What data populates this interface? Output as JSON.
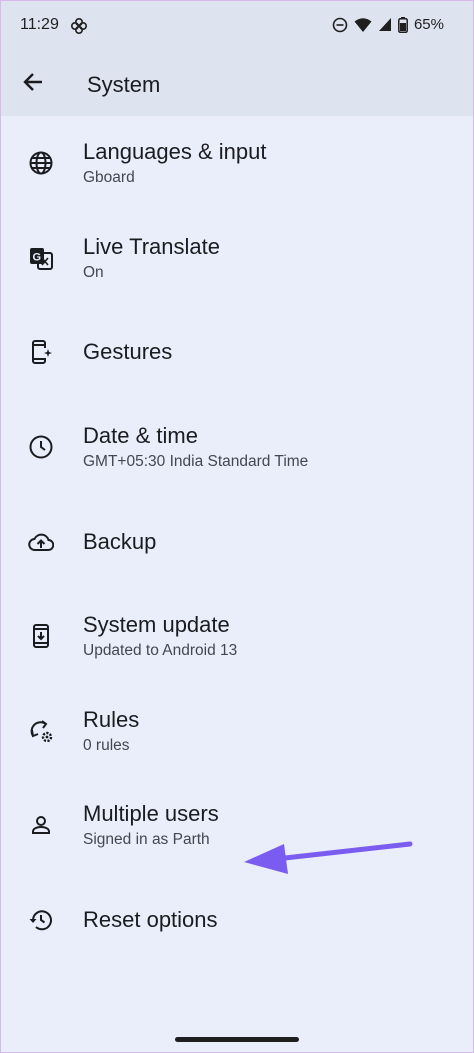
{
  "status_bar": {
    "time": "11:29",
    "battery": "65%",
    "icons": [
      "pinwheel-icon",
      "do-not-disturb-icon",
      "wifi-icon",
      "signal-icon",
      "battery-icon"
    ]
  },
  "app_bar": {
    "back_icon": "arrow-back-icon",
    "title": "System"
  },
  "items": [
    {
      "icon": "globe-icon",
      "title": "Languages & input",
      "subtitle": "Gboard"
    },
    {
      "icon": "translate-icon",
      "title": "Live Translate",
      "subtitle": "On"
    },
    {
      "icon": "phone-gesture-icon",
      "title": "Gestures",
      "subtitle": ""
    },
    {
      "icon": "clock-icon",
      "title": "Date & time",
      "subtitle": "GMT+05:30 India Standard Time"
    },
    {
      "icon": "cloud-upload-icon",
      "title": "Backup",
      "subtitle": ""
    },
    {
      "icon": "system-update-icon",
      "title": "System update",
      "subtitle": "Updated to Android 13"
    },
    {
      "icon": "rules-icon",
      "title": "Rules",
      "subtitle": "0 rules"
    },
    {
      "icon": "person-icon",
      "title": "Multiple users",
      "subtitle": "Signed in as Parth"
    },
    {
      "icon": "history-icon",
      "title": "Reset options",
      "subtitle": ""
    }
  ],
  "annotation": {
    "color": "#7b5cf0"
  },
  "colors": {
    "background": "#eaeefa",
    "header": "#dde3ef",
    "text": "#1b1c20",
    "subtext": "#44474f"
  }
}
